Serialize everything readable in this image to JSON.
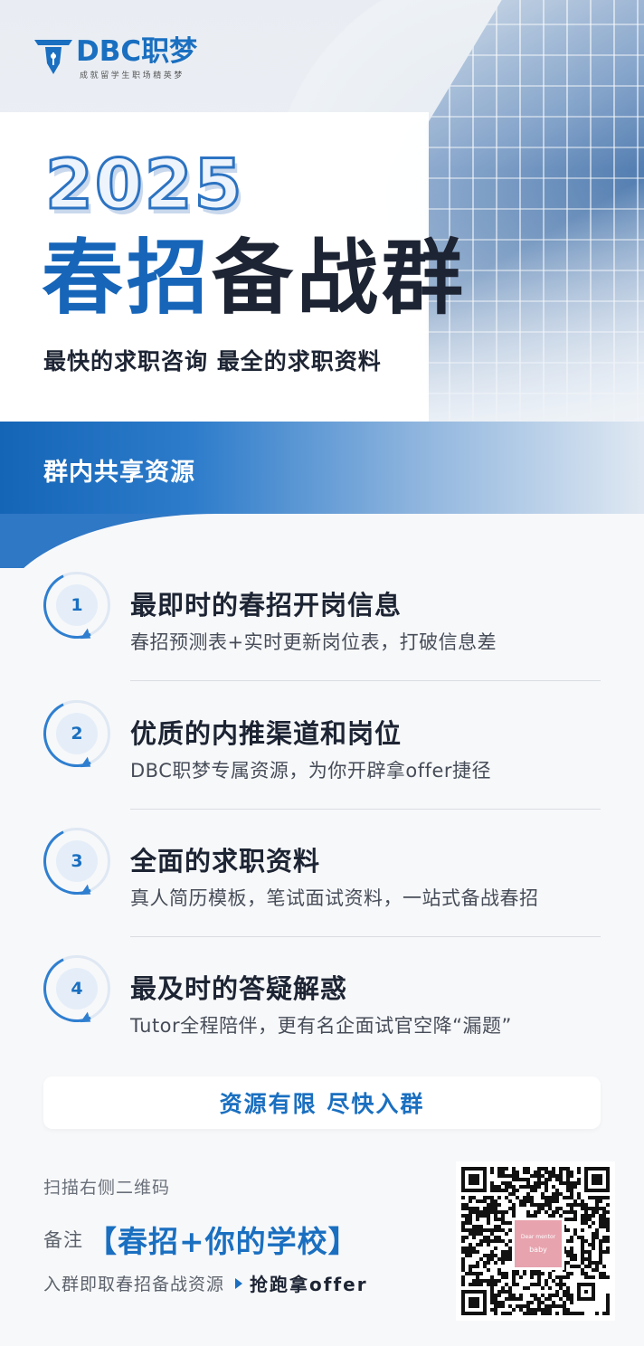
{
  "brand": {
    "name": "DBC职梦",
    "slogan": "成就留学生职场精英梦"
  },
  "hero": {
    "year": "2025",
    "headline_blue": "春招",
    "headline_dark": "备战群",
    "tagline": "最快的求职咨询 最全的求职资料"
  },
  "band": {
    "label": "群内共享资源"
  },
  "items": [
    {
      "number": "1",
      "title": "最即时的春招开岗信息",
      "desc": "春招预测表+实时更新岗位表，打破信息差"
    },
    {
      "number": "2",
      "title": "优质的内推渠道和岗位",
      "desc": "DBC职梦专属资源，为你开辟拿offer捷径"
    },
    {
      "number": "3",
      "title": "全面的求职资料",
      "desc": "真人简历模板，笔试面试资料，一站式备战春招"
    },
    {
      "number": "4",
      "title": "最及时的答疑解惑",
      "desc": "Tutor全程陪伴，更有名企面试官空降“漏题”"
    }
  ],
  "cta": {
    "label": "资源有限 尽快入群"
  },
  "footer": {
    "scan": "扫描右侧二维码",
    "remark_label": "备注",
    "remark_value": "【春招+你的学校】",
    "join_text": "入群即取春招备战资源",
    "join_cta": "抢跑拿offer"
  },
  "qr": {
    "badge_top": "Dear mentor",
    "badge_bottom": "baby"
  },
  "colors": {
    "primary": "#1a6fc0",
    "dark": "#1d2433",
    "badge": "#e7a3ae"
  }
}
